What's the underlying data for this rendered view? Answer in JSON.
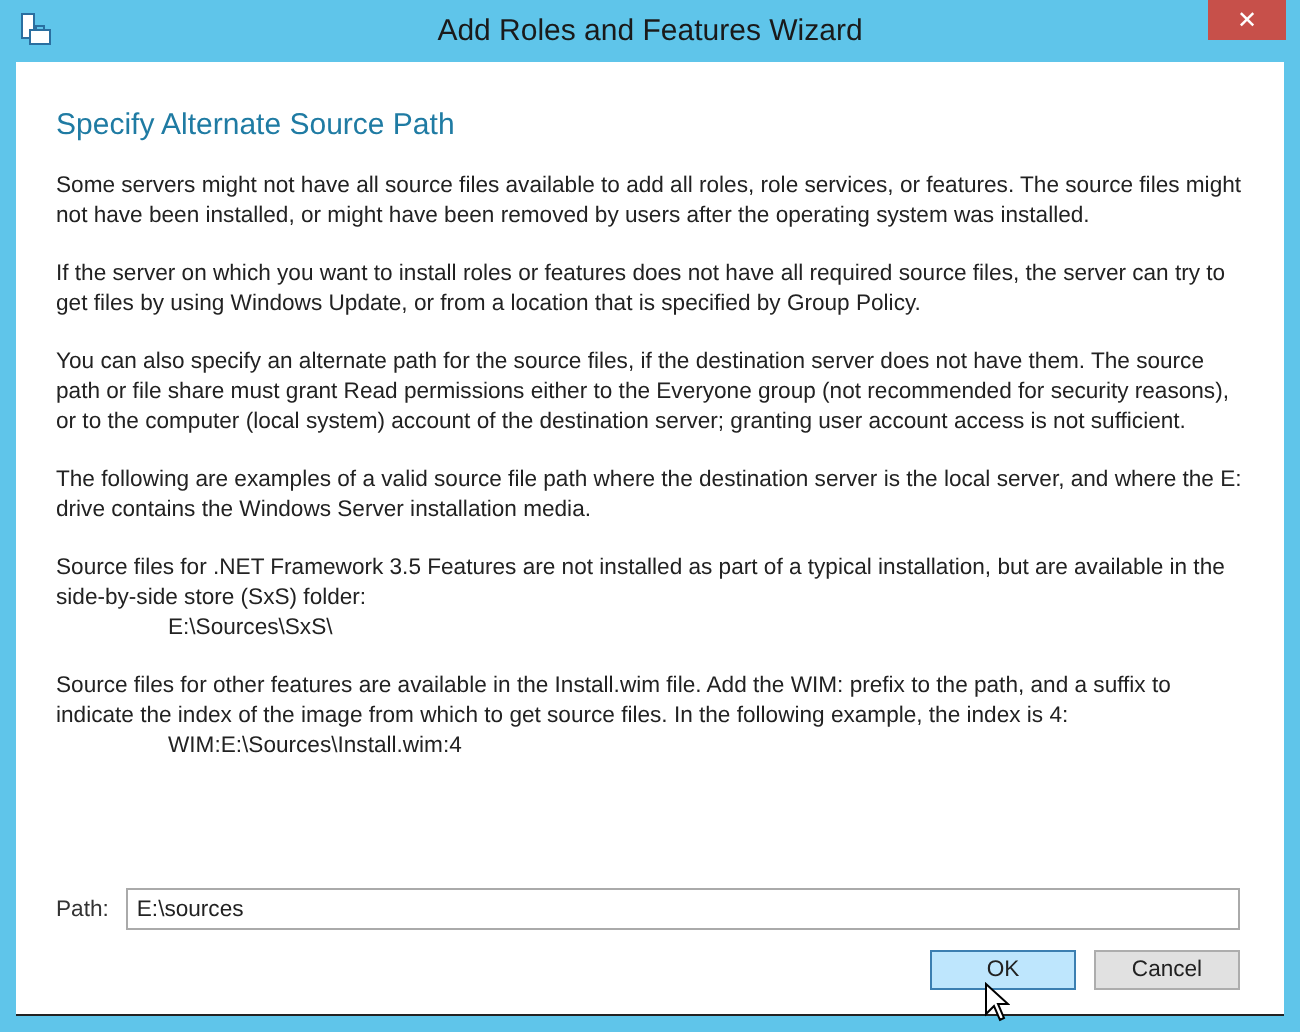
{
  "window": {
    "title": "Add Roles and Features Wizard",
    "close": "✕"
  },
  "heading": "Specify Alternate Source Path",
  "paragraphs": [
    {
      "text": "Some servers might not have all source files available to add all roles, role services, or features. The source files might not have been installed, or might have been removed by users after the operating system was installed."
    },
    {
      "text": "If the server on which you want to install roles or features does not have all required source files, the server can try to get files by using Windows Update, or from a location that is specified by Group Policy."
    },
    {
      "text": "You can also specify an alternate path for the source files, if the destination server does not have them. The source path or file share must grant Read permissions either to the Everyone group (not recommended for security reasons), or to the computer (local system) account of the destination server; granting user account access is not sufficient."
    },
    {
      "text": "The following are examples of a valid source file path where the destination server is the local server, and where the E: drive contains the Windows Server installation media."
    },
    {
      "text": "Source files for .NET Framework 3.5 Features are not installed as part of a typical installation, but are available in the side-by-side store (SxS) folder:",
      "example": "E:\\Sources\\SxS\\"
    },
    {
      "text": "Source files for other features are available in the Install.wim file. Add the WIM: prefix to the path, and a suffix to indicate the index of the image from which to get source files. In the following example, the index is 4:",
      "example": "WIM:E:\\Sources\\Install.wim:4"
    }
  ],
  "path_field": {
    "label": "Path:",
    "value": "E:\\sources"
  },
  "buttons": [
    {
      "label": "OK",
      "highlighted": true
    },
    {
      "label": "Cancel",
      "highlighted": false
    }
  ]
}
